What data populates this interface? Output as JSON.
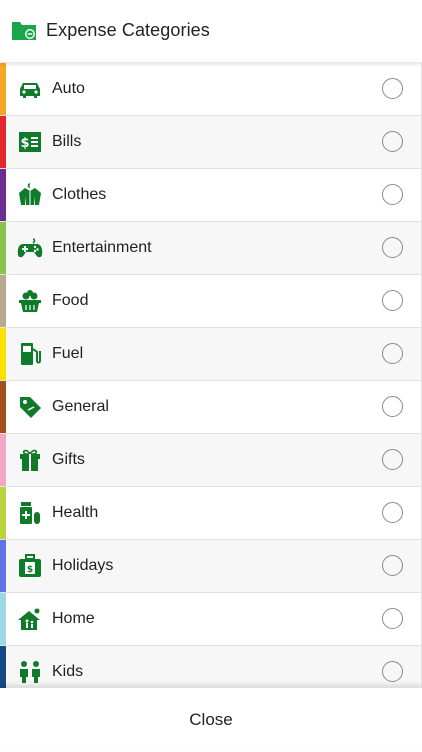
{
  "header": {
    "title": "Expense Categories",
    "icon": "folder-icon"
  },
  "accent": "#0f7a2a",
  "categories": [
    {
      "label": "Auto",
      "color": "#f5a623",
      "icon": "car-icon",
      "selected": false
    },
    {
      "label": "Bills",
      "color": "#e3262b",
      "icon": "bill-icon",
      "selected": false
    },
    {
      "label": "Clothes",
      "color": "#6b2d8f",
      "icon": "jacket-icon",
      "selected": false
    },
    {
      "label": "Entertainment",
      "color": "#8bc34a",
      "icon": "gamepad-icon",
      "selected": false
    },
    {
      "label": "Food",
      "color": "#b8a98f",
      "icon": "food-basket-icon",
      "selected": false
    },
    {
      "label": "Fuel",
      "color": "#f8e100",
      "icon": "fuel-pump-icon",
      "selected": false
    },
    {
      "label": "General",
      "color": "#a0521a",
      "icon": "tag-icon",
      "selected": false
    },
    {
      "label": "Gifts",
      "color": "#f2a6c2",
      "icon": "gift-icon",
      "selected": false
    },
    {
      "label": "Health",
      "color": "#b7d43a",
      "icon": "medicine-icon",
      "selected": false
    },
    {
      "label": "Holidays",
      "color": "#5b74e6",
      "icon": "luggage-icon",
      "selected": false
    },
    {
      "label": "Home",
      "color": "#9ed8e8",
      "icon": "house-icon",
      "selected": false
    },
    {
      "label": "Kids",
      "color": "#134a84",
      "icon": "kids-icon",
      "selected": false
    }
  ],
  "footer": {
    "close_label": "Close"
  }
}
